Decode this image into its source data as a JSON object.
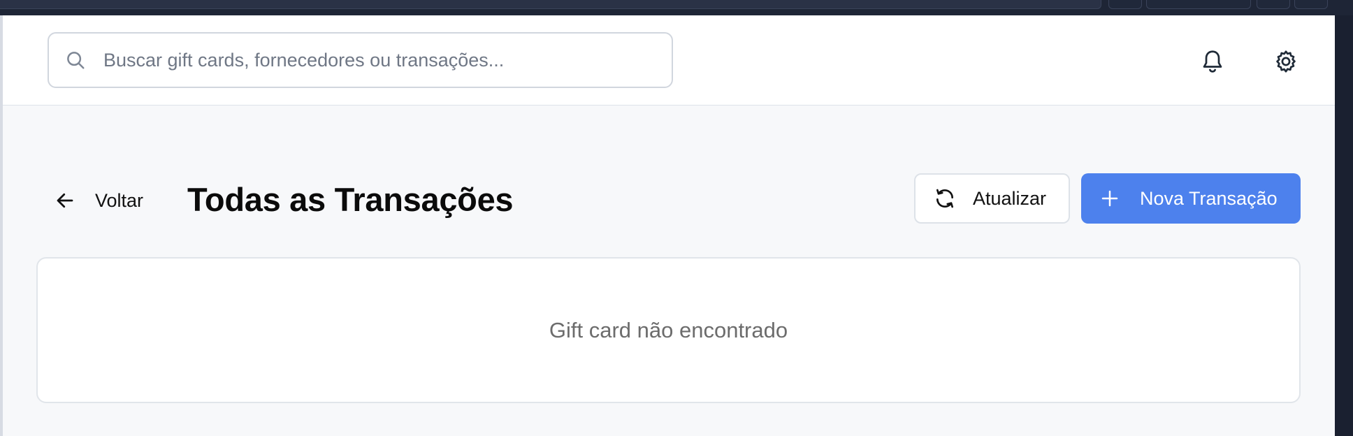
{
  "header": {
    "search": {
      "placeholder": "Buscar gift cards, fornecedores ou transações...",
      "icon": "search-icon"
    },
    "icons": [
      "bell-icon",
      "gear-icon"
    ]
  },
  "toolbar": {
    "back_label": "Voltar",
    "title": "Todas as Transações",
    "refresh_label": "Atualizar",
    "new_label": "Nova Transação"
  },
  "content": {
    "empty_message": "Gift card não encontrado"
  },
  "colors": {
    "primary": "#4d81ed",
    "background": "#f7f8fa",
    "text_muted": "#6c6c6c"
  }
}
